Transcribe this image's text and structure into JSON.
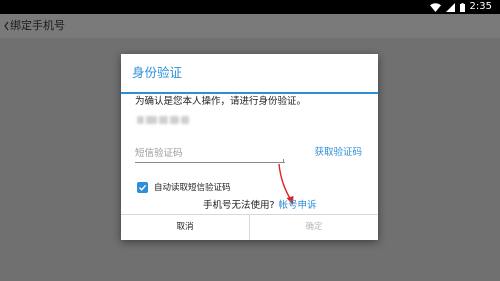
{
  "status_bar": {
    "time": "2:35",
    "icons": [
      "wifi-icon",
      "signal-icon",
      "battery-icon"
    ]
  },
  "app_bar": {
    "title": "绑定手机号",
    "back_icon": "chevron-left-icon"
  },
  "dialog": {
    "title": "身份验证",
    "message": "为确认是您本人操作，请进行身份验证。",
    "code_input": {
      "value": "",
      "placeholder": "短信验证码"
    },
    "get_code_label": "获取验证码",
    "auto_read_label": "自动读取短信验证码",
    "auto_read_checked": true,
    "appeal_question": "手机号无法使用?",
    "appeal_link": "帐号申诉",
    "cancel_label": "取消",
    "confirm_label": "确定",
    "accent_color": "#2d8fd8"
  }
}
